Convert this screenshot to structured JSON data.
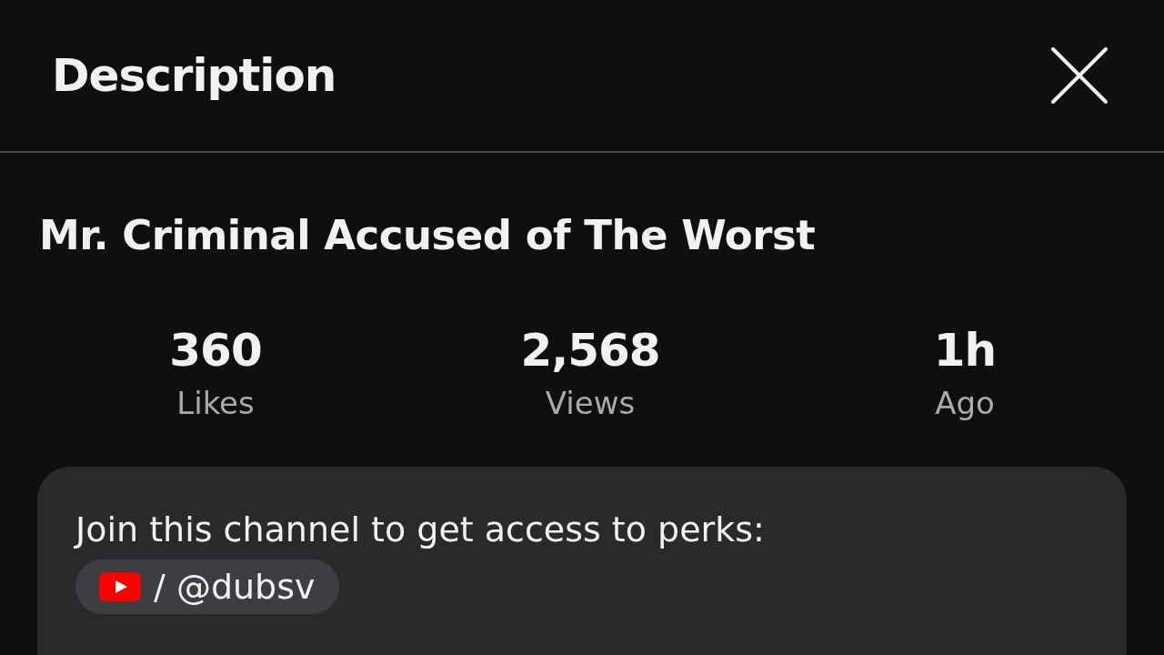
{
  "header": {
    "title": "Description"
  },
  "video": {
    "title": "Mr. Criminal Accused of The Worst"
  },
  "stats": [
    {
      "value": "360",
      "label": "Likes"
    },
    {
      "value": "2,568",
      "label": "Views"
    },
    {
      "value": "1h",
      "label": "Ago"
    }
  ],
  "description": {
    "text": "Join this channel to get access to perks:",
    "link": "/ @dubsv"
  }
}
